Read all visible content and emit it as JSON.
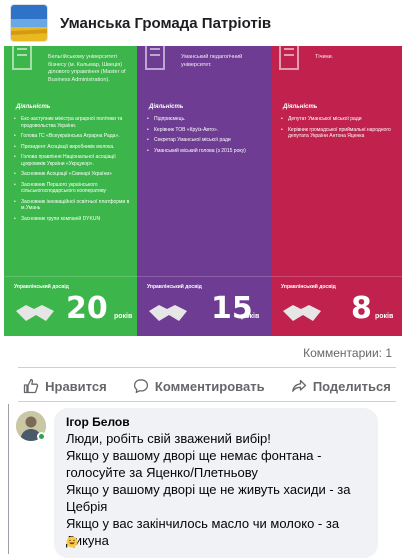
{
  "page": {
    "name": "Уманська Громада Патріотів"
  },
  "infographic": {
    "columns": [
      {
        "top_text": "Бельгійському університеті бізнесу (м. Кальмар, Швеція) ділового управління (Master of Business Administration).",
        "section_title": "Діяльність",
        "items": [
          "Екс-заступник міністра аграрної політики та продовольства України.",
          "Голова ГС «Всеукраїнська Аграрна Рада».",
          "Президент Асоціації виробників молока.",
          "Голова правління Національної асоціації цукровиків України «Укрцукор».",
          "Засновник Асоціації «Свинарі України»",
          "Засновник Першого українського сільськогосподарського кооперативу",
          "Засновник інноваційної освітньої платформи в м.Умань",
          "Засновник групи компаній DYKUN"
        ],
        "income_label": "Управлінський досвід",
        "years": "20",
        "years_word": "років"
      },
      {
        "top_text": "Уманський педагогічний університет.",
        "section_title": "Діяльність",
        "items": [
          "Підприємець.",
          "Керівник ТОВ «Круїз-Авто».",
          "Секретар Уманської міської ради",
          "Уманський міський голова (з 2015 року)"
        ],
        "income_label": "Управлінський досвід",
        "years": "15",
        "years_word": "років"
      },
      {
        "top_text": "Тічини.",
        "section_title": "Діяльність",
        "items": [
          "Депутат Уманської міської ради",
          "Керівник громадської приймальні народного депутата України Антона Яценка"
        ],
        "income_label": "Управлінський досвід",
        "years": "8",
        "years_word": "років"
      }
    ]
  },
  "stats": {
    "comments": "Комментарии: 1"
  },
  "actions": {
    "like": "Нравится",
    "comment": "Комментировать",
    "share": "Поделиться"
  },
  "comment": {
    "author": "Ігор Белов",
    "lines": [
      "Люди, робіть свій зважений вибір!",
      "Якщо у вашому дворі ще немає фонтана - голосуйте за Яценко/Плетньову",
      "Якщо у вашому дворі ще не живуть хасиди - за Цебрія",
      "Якщо у вас закінчилось масло чи молоко - за Дикуна"
    ]
  }
}
